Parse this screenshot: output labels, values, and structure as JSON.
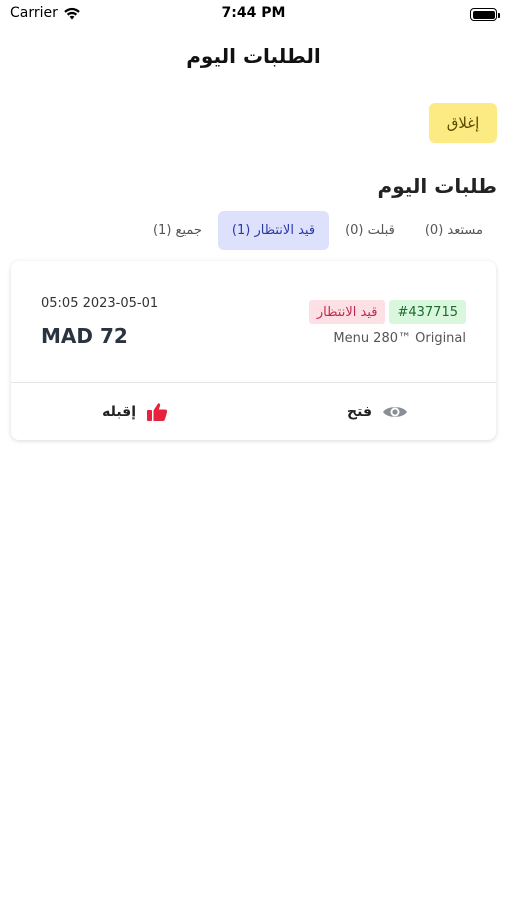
{
  "status_bar": {
    "carrier": "Carrier",
    "time": "7:44 PM",
    "icons": [
      "wifi-icon",
      "battery-icon"
    ]
  },
  "nav": {
    "title": "الطلبات اليوم"
  },
  "close_button": {
    "label": "إغلاق",
    "color": "#fbeb82"
  },
  "section": {
    "title": "طلبات اليوم"
  },
  "tabs": [
    {
      "label": "جميع (1)",
      "active": false
    },
    {
      "label": "قيد الانتظار (1)",
      "active": true
    },
    {
      "label": "قبلت (0)",
      "active": false
    },
    {
      "label": "مستعد (0)",
      "active": false
    }
  ],
  "order": {
    "id": "#437715",
    "status": "قيد الانتظار",
    "menu": "Menu 280™ Original",
    "date": "05:05 2023-05-01",
    "price": "MAD 72",
    "actions": {
      "open_label": "فتح",
      "open_icon": "eye-icon",
      "accept_label": "إقبله",
      "accept_icon": "thumbs-up-icon",
      "accept_color": "#e8213c"
    }
  }
}
